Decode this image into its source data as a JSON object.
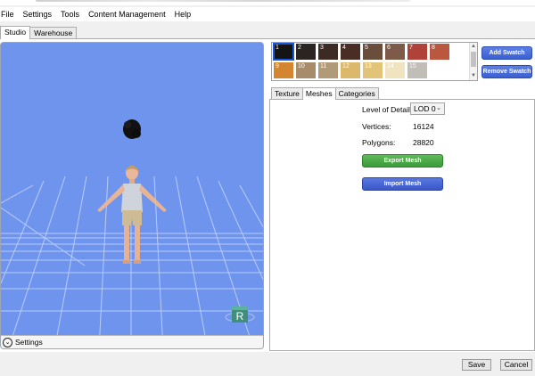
{
  "menu": [
    "File",
    "Settings",
    "Tools",
    "Content Management",
    "Help"
  ],
  "tabs": [
    {
      "label": "Studio",
      "active": true
    },
    {
      "label": "Warehouse",
      "active": false
    }
  ],
  "viewport": {
    "background": "#6e94ee",
    "gizmo_label": "R",
    "settings_label": "Settings"
  },
  "swatches": {
    "row1": [
      {
        "num": "1",
        "color": "#141414",
        "selected": true
      },
      {
        "num": "2",
        "color": "#2a2522"
      },
      {
        "num": "3",
        "color": "#3d2a23"
      },
      {
        "num": "4",
        "color": "#4a2e26"
      },
      {
        "num": "5",
        "color": "#6a4e3c"
      },
      {
        "num": "6",
        "color": "#7e5a49"
      },
      {
        "num": "7",
        "color": "#b0423a"
      },
      {
        "num": "8",
        "color": "#b9583f"
      }
    ],
    "row2": [
      {
        "num": "9",
        "color": "#d3852f"
      },
      {
        "num": "10",
        "color": "#a78c6b"
      },
      {
        "num": "11",
        "color": "#b09a77"
      },
      {
        "num": "12",
        "color": "#dcb86d"
      },
      {
        "num": "13",
        "color": "#e1c477"
      },
      {
        "num": "14",
        "color": "#f0e4c0"
      },
      {
        "num": "15",
        "color": "#c1bdb7"
      }
    ],
    "add_label": "Add Swatch",
    "remove_label": "Remove Swatch"
  },
  "subtabs": [
    {
      "label": "Texture",
      "active": false
    },
    {
      "label": "Meshes",
      "active": true
    },
    {
      "label": "Categories",
      "active": false
    }
  ],
  "meshes": {
    "lod_label": "Level of Detail:",
    "lod_value": "LOD 0",
    "vertices_label": "Vertices:",
    "vertices_value": "16124",
    "polygons_label": "Polygons:",
    "polygons_value": "28820",
    "export_label": "Export Mesh",
    "import_label": "Import Mesh"
  },
  "footer": {
    "save_label": "Save",
    "cancel_label": "Cancel"
  }
}
